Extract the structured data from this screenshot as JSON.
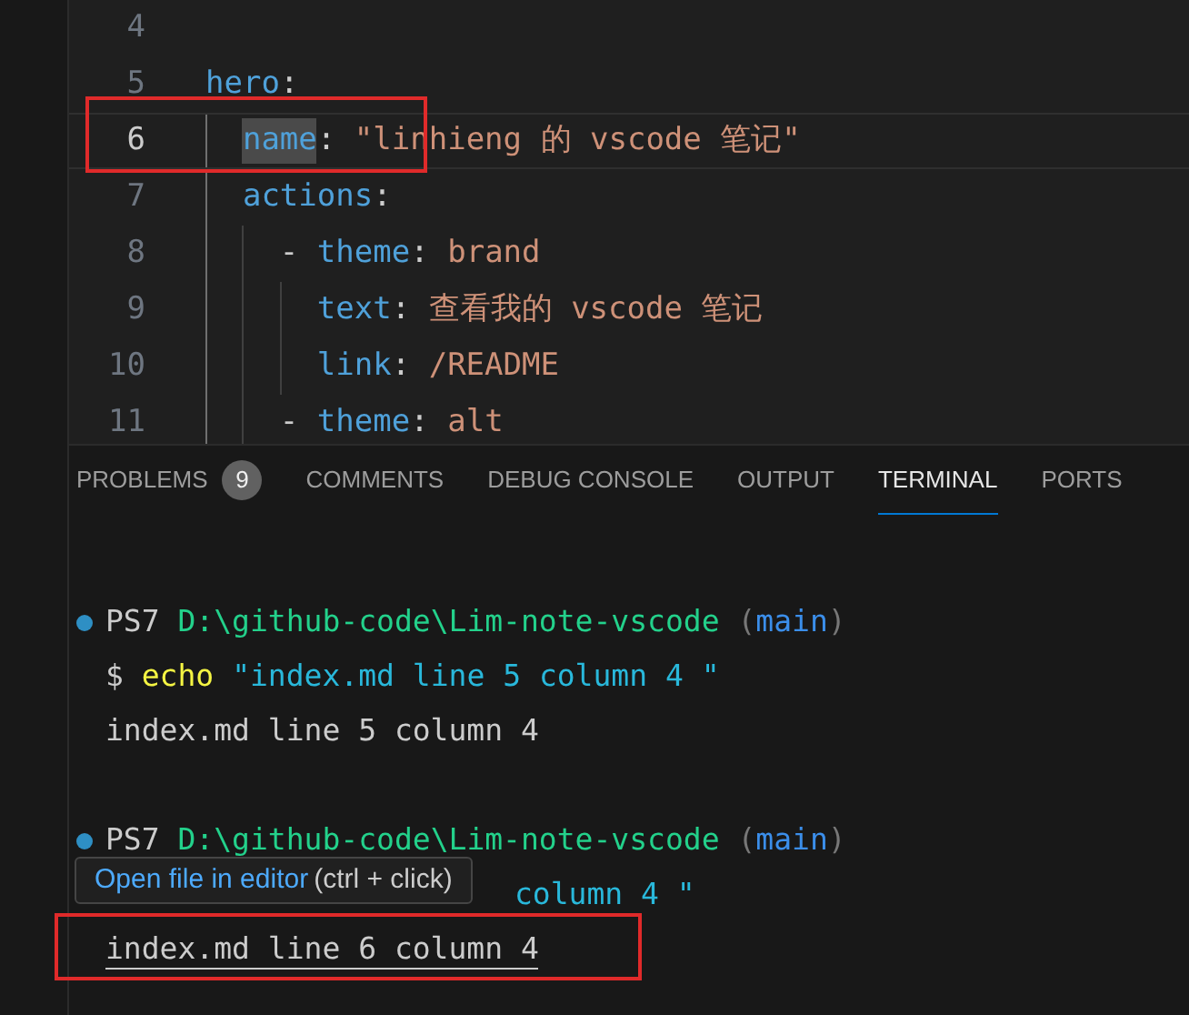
{
  "editor": {
    "lines": [
      {
        "number": "4",
        "current": false
      },
      {
        "number": "5",
        "current": false,
        "tokens": [
          {
            "text": "hero",
            "kind": "key"
          },
          {
            "text": ":",
            "kind": "punct"
          }
        ],
        "children": [
          {
            "number": "6",
            "current": true,
            "tokens": [
              {
                "text": "name",
                "kind": "key",
                "highlighted": true
              },
              {
                "text": ":",
                "kind": "punct"
              },
              {
                "text": "\"linhieng 的 vscode 笔记\"",
                "kind": "string"
              }
            ]
          },
          {
            "number": "7",
            "current": false,
            "tokens": [
              {
                "text": "actions",
                "kind": "key"
              },
              {
                "text": ":",
                "kind": "punct"
              }
            ],
            "children": [
              {
                "number": "8",
                "current": false,
                "tokens": [
                  {
                    "text": "-",
                    "kind": "dash"
                  },
                  {
                    "text": "theme",
                    "kind": "key"
                  },
                  {
                    "text": ":",
                    "kind": "punct"
                  },
                  {
                    "text": "brand",
                    "kind": "string"
                  }
                ],
                "children": [
                  {
                    "number": "9",
                    "current": false,
                    "tokens": [
                      {
                        "text": "text",
                        "kind": "key"
                      },
                      {
                        "text": ":",
                        "kind": "punct"
                      },
                      {
                        "text": "查看我的 vscode 笔记",
                        "kind": "string"
                      }
                    ]
                  },
                  {
                    "number": "10",
                    "current": false,
                    "tokens": [
                      {
                        "text": "link",
                        "kind": "key"
                      },
                      {
                        "text": ":",
                        "kind": "punct"
                      },
                      {
                        "text": "/README",
                        "kind": "string"
                      }
                    ]
                  }
                ]
              },
              {
                "number": "11",
                "current": false,
                "tokens": [
                  {
                    "text": "-",
                    "kind": "dash"
                  },
                  {
                    "text": "theme",
                    "kind": "key"
                  },
                  {
                    "text": ":",
                    "kind": "punct"
                  },
                  {
                    "text": "alt",
                    "kind": "string"
                  }
                ]
              }
            ]
          }
        ]
      }
    ]
  },
  "panel": {
    "tabs": [
      {
        "label": "PROBLEMS",
        "badge": "9",
        "selected": false
      },
      {
        "label": "COMMENTS",
        "selected": false
      },
      {
        "label": "DEBUG CONSOLE",
        "selected": false
      },
      {
        "label": "OUTPUT",
        "selected": false
      },
      {
        "label": "TERMINAL",
        "selected": true
      },
      {
        "label": "PORTS",
        "selected": false
      }
    ]
  },
  "terminal": {
    "lines": [
      {
        "kind": "blank"
      },
      {
        "kind": "prompt",
        "shell": "PS7",
        "path": "D:\\github-code\\Lim-note-vscode",
        "open": "(",
        "branch": "main",
        "close": ")"
      },
      {
        "kind": "command",
        "sign": "$",
        "command": "echo",
        "argument": "\"index.md line 5 column 4 \""
      },
      {
        "kind": "output",
        "text": "index.md line 5 column 4",
        "underlined": false
      },
      {
        "kind": "blank"
      },
      {
        "kind": "prompt",
        "shell": "PS7",
        "path": "D:\\github-code\\Lim-note-vscode",
        "open": "(",
        "branch": "main",
        "close": ")"
      },
      {
        "kind": "covered",
        "text": "column 4 \""
      },
      {
        "kind": "output",
        "text": "index.md line 6 column 4",
        "underlined": true
      }
    ],
    "tooltip": {
      "link": "Open file in editor",
      "hint": "(ctrl + click)"
    }
  }
}
